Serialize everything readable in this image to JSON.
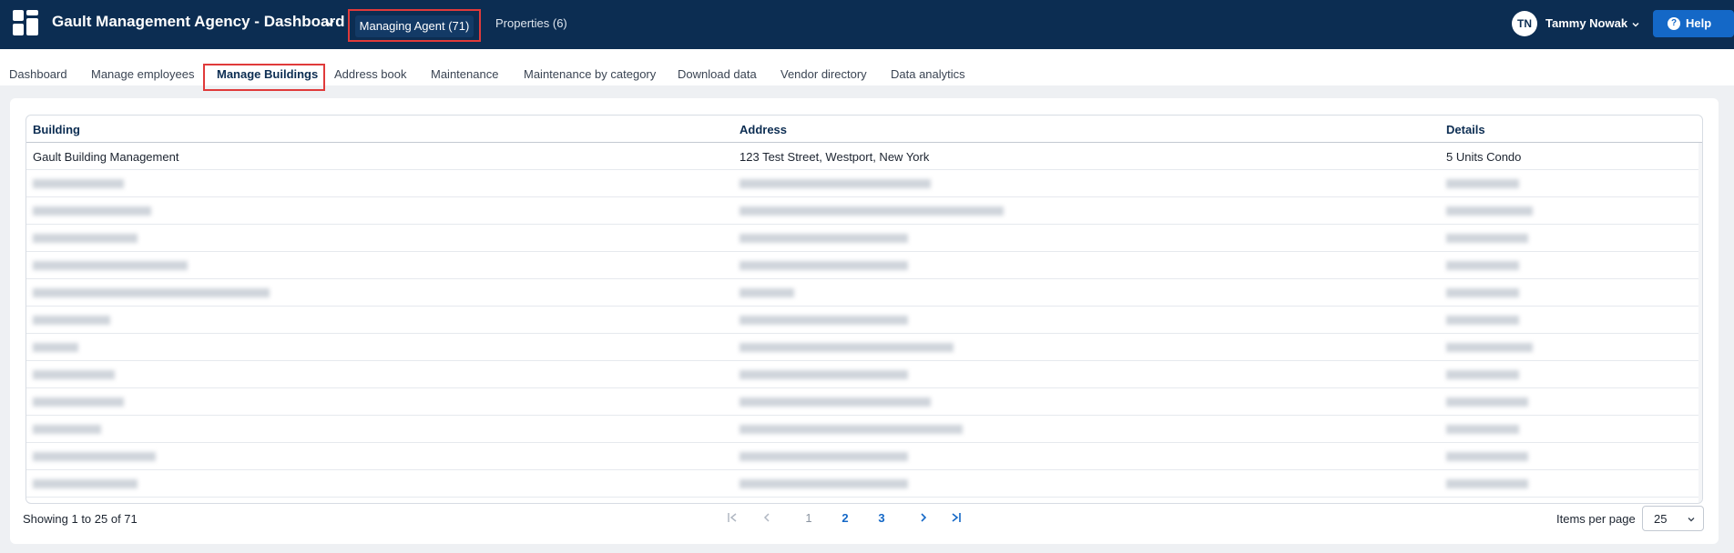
{
  "header": {
    "app_title": "Gault Management Agency - Dashboard",
    "nav_managing_agent": "Managing Agent (71)",
    "nav_properties": "Properties (6)",
    "user_initials": "TN",
    "user_name": "Tammy Nowak",
    "help_label": "Help"
  },
  "subnav": {
    "items": [
      "Dashboard",
      "Manage employees",
      "Manage Buildings",
      "Address book",
      "Maintenance",
      "Maintenance by category",
      "Download data",
      "Vendor directory",
      "Data analytics"
    ],
    "active_index": 2
  },
  "table": {
    "columns": [
      "Building",
      "Address",
      "Details"
    ],
    "first_row": {
      "building": "Gault Building Management",
      "address": "123 Test Street, Westport, New York",
      "details": "5 Units Condo"
    }
  },
  "footer": {
    "showing": "Showing 1 to 25 of 71",
    "pages": [
      "1",
      "2",
      "3"
    ],
    "first_icon": "first-page-icon",
    "prev_icon": "prev-page-icon",
    "next_icon": "next-page-icon",
    "last_icon": "last-page-icon",
    "items_per_page_label": "Items per page",
    "items_per_page_value": "25"
  }
}
